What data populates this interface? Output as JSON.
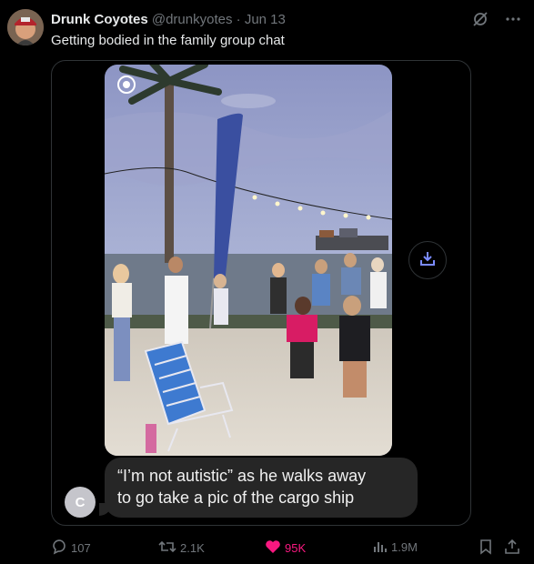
{
  "tweet": {
    "display_name": "Drunk Coyotes",
    "handle": "@drunkyotes",
    "separator": "·",
    "date": "Jun 13",
    "text": "Getting bodied in the family group chat"
  },
  "media": {
    "bubble_line1": "“I’m not autistic” as he walks away",
    "bubble_line2": "to go take a pic of the cargo ship",
    "contact_initial": "C"
  },
  "actions": {
    "replies": "107",
    "reposts": "2.1K",
    "likes": "95K",
    "views": "1.9M"
  },
  "colors": {
    "like_active": "#f91880",
    "muted": "#71767b",
    "download_accent": "#1d9bf0"
  },
  "icons": [
    "grok-icon",
    "more-icon",
    "download-icon",
    "reply-icon",
    "repost-icon",
    "heart-icon",
    "views-icon",
    "bookmark-icon",
    "share-icon"
  ]
}
